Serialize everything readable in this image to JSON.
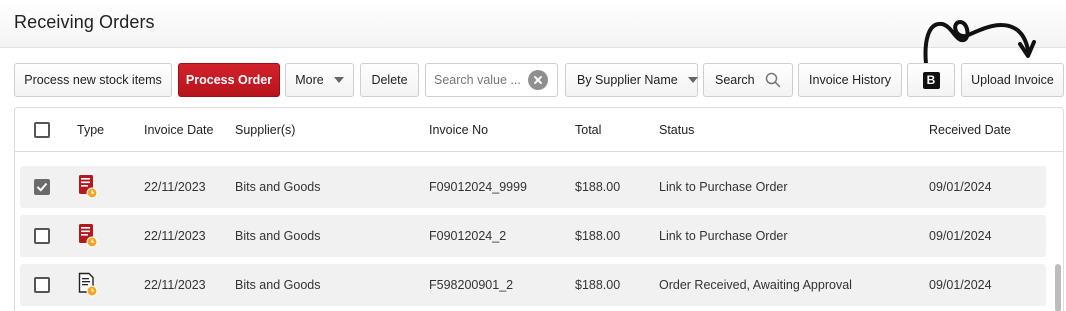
{
  "page": {
    "title": "Receiving Orders"
  },
  "toolbar": {
    "process_new_label": "Process new stock items",
    "process_order_label": "Process Order",
    "more_label": "More",
    "delete_label": "Delete",
    "search_placeholder": "Search value ...",
    "filter_label": "By Supplier Name",
    "search_label": "Search",
    "invoice_history_label": "Invoice History",
    "b_label": "B",
    "upload_label": "Upload Invoice"
  },
  "table": {
    "columns": [
      "Type",
      "Invoice Date",
      "Supplier(s)",
      "Invoice No",
      "Total",
      "Status",
      "Received Date"
    ],
    "rows": [
      {
        "checked": true,
        "type_icon": "red-invoice-icon",
        "invoice_date": "22/11/2023",
        "supplier": "Bits and Goods",
        "invoice_no": "F09012024_9999",
        "total": "$188.00",
        "status": "Link to Purchase Order",
        "received_date": "09/01/2024"
      },
      {
        "checked": false,
        "type_icon": "red-invoice-icon",
        "invoice_date": "22/11/2023",
        "supplier": "Bits and Goods",
        "invoice_no": "F09012024_2",
        "total": "$188.00",
        "status": "Link to Purchase Order",
        "received_date": "09/01/2024"
      },
      {
        "checked": false,
        "type_icon": "document-invoice-icon",
        "invoice_date": "22/11/2023",
        "supplier": "Bits and Goods",
        "invoice_no": "F598200901_2",
        "total": "$188.00",
        "status": "Order Received, Awaiting Approval",
        "received_date": "09/01/2024"
      }
    ]
  },
  "colors": {
    "primary": "#c41a23",
    "row_bg": "#f1f1f1",
    "badge": "#f5a623"
  }
}
